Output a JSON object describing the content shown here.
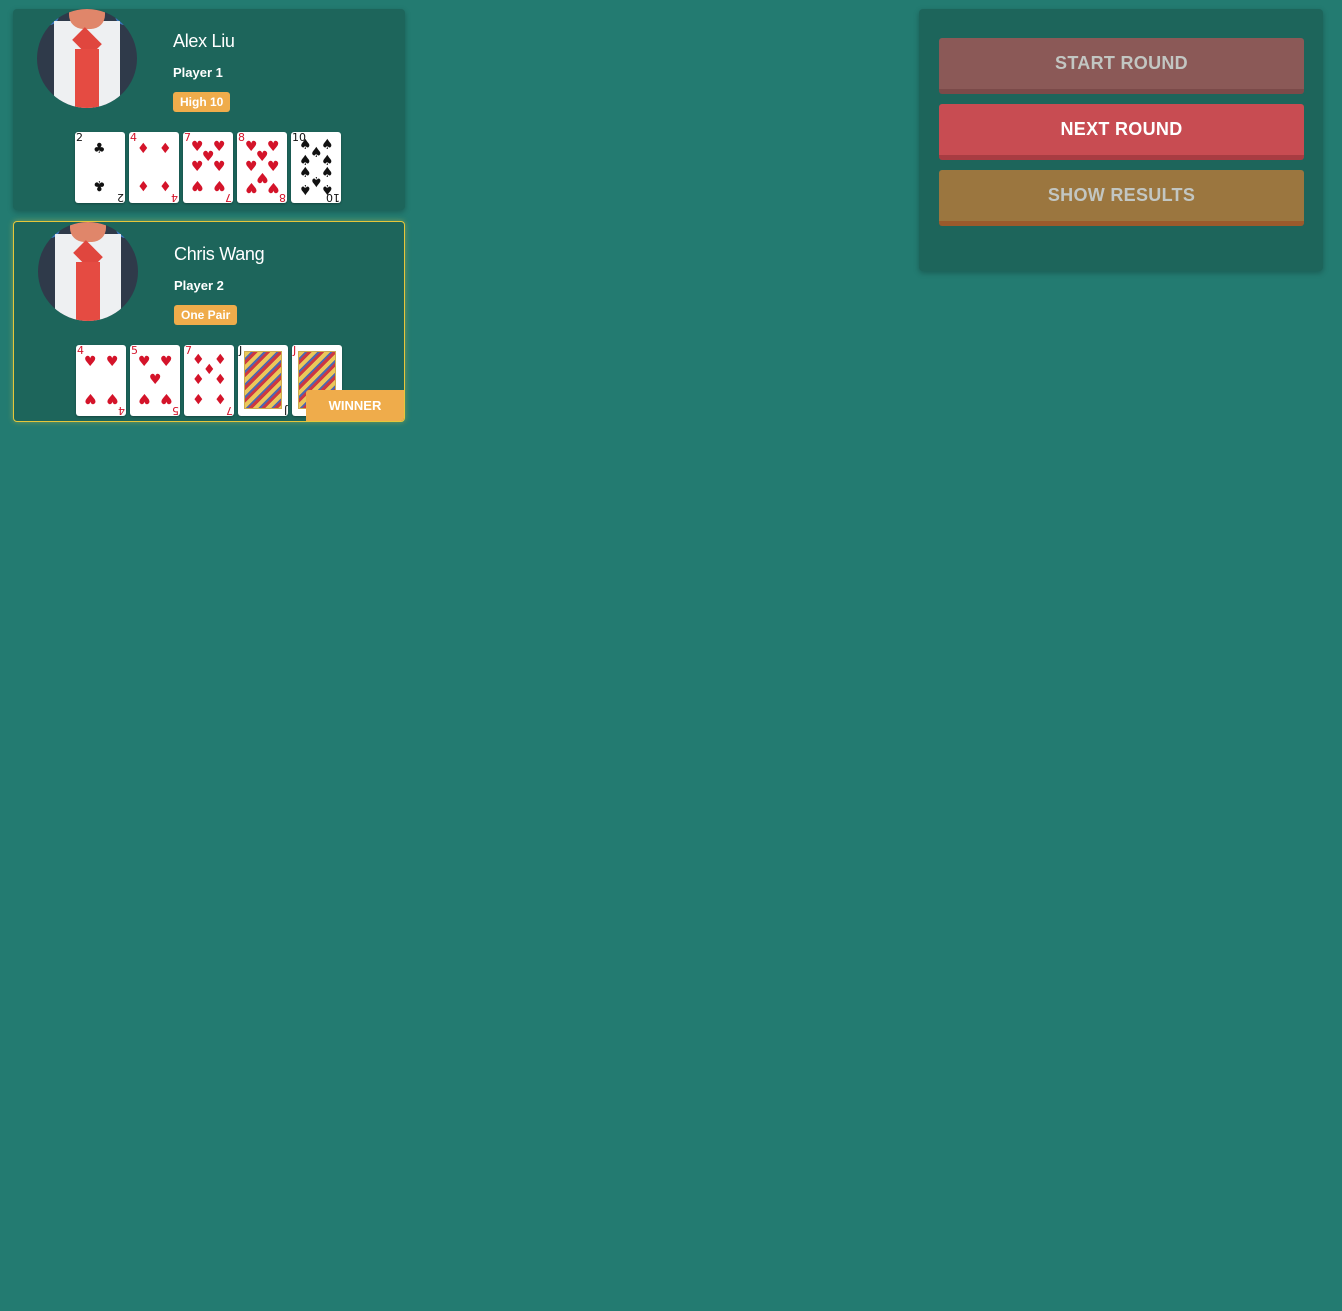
{
  "colors": {
    "table": "#237b71",
    "panel": "#1d655b",
    "badge": "#efac4b",
    "start": "#8b5957",
    "next": "#c84c52",
    "results": "#9b763f",
    "winner_border": "#e6c63a"
  },
  "players": [
    {
      "name": "Alex Liu",
      "label": "Player 1",
      "hand": "High 10",
      "cards": [
        {
          "rank": "2",
          "suit": "♣",
          "color": "black"
        },
        {
          "rank": "4",
          "suit": "♦",
          "color": "red"
        },
        {
          "rank": "7",
          "suit": "♥",
          "color": "red"
        },
        {
          "rank": "8",
          "suit": "♥",
          "color": "red"
        },
        {
          "rank": "10",
          "suit": "♠",
          "color": "black"
        }
      ]
    },
    {
      "name": "Chris Wang",
      "label": "Player 2",
      "hand": "One Pair",
      "winner_label": "WINNER",
      "cards": [
        {
          "rank": "4",
          "suit": "♥",
          "color": "red"
        },
        {
          "rank": "5",
          "suit": "♥",
          "color": "red"
        },
        {
          "rank": "7",
          "suit": "♦",
          "color": "red"
        },
        {
          "rank": "J",
          "suit": "♣",
          "color": "black"
        },
        {
          "rank": "J",
          "suit": "♥",
          "color": "red"
        }
      ]
    }
  ],
  "controls": {
    "start_label": "START ROUND",
    "next_label": "NEXT ROUND",
    "results_label": "SHOW RESULTS"
  }
}
